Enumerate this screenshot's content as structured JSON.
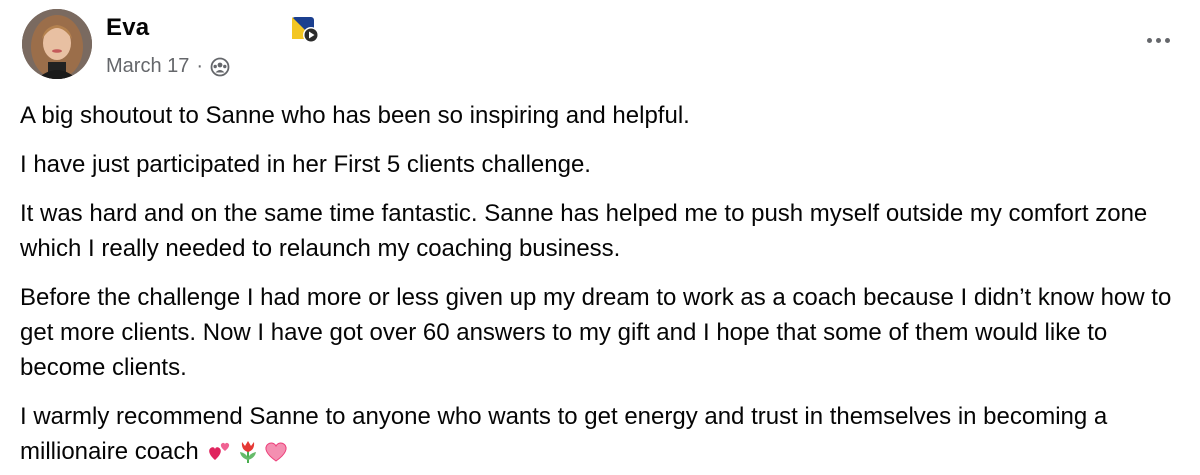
{
  "post": {
    "author": "Eva",
    "date": "March 17",
    "separator": "·",
    "audience_icon": "group-audience-icon",
    "more_icon": "more-options-icon",
    "paragraphs": [
      "A big shoutout to Sanne who has been so inspiring and helpful.",
      "I have just participated in her First 5 clients challenge.",
      "It was hard and on the same time fantastic. Sanne has helped me to push myself outside my comfort zone which I really needed to relaunch my coaching business.",
      "Before the challenge I had more or less given up my dream to work as a coach because I didn’t know how to get more clients. Now I have got over 60 answers to my gift and I hope that some of them would like to become clients.",
      "I warmly recommend Sanne to anyone who wants to get energy and trust in themselves in becoming a millionaire coach"
    ],
    "emojis": [
      "two-hearts-icon",
      "tulip-icon",
      "pink-heart-icon"
    ]
  },
  "colors": {
    "text": "#050505",
    "meta": "#65676b",
    "badge_blue": "#1b3f8f",
    "badge_yellow": "#f3c623"
  }
}
